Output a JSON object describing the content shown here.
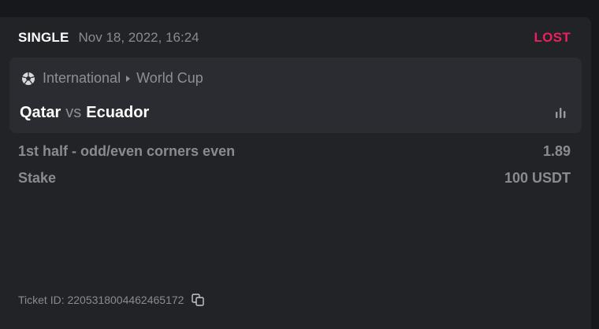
{
  "bet": {
    "type": "SINGLE",
    "date": "Nov 18, 2022, 16:24",
    "status": "LOST",
    "status_color": "#ee1f5e"
  },
  "event": {
    "sport_icon": "soccer-ball-icon",
    "category": "International",
    "tournament": "World Cup",
    "home_team": "Qatar",
    "vs": "vs",
    "away_team": "Ecuador",
    "stats_icon": "bar-chart-icon"
  },
  "selection": {
    "market": "1st half - odd/even corners even",
    "odds": "1.89"
  },
  "stake": {
    "label": "Stake",
    "value": "100 USDT"
  },
  "ticket": {
    "text": "Ticket ID: 2205318004462465172",
    "copy_icon": "copy-icon"
  }
}
